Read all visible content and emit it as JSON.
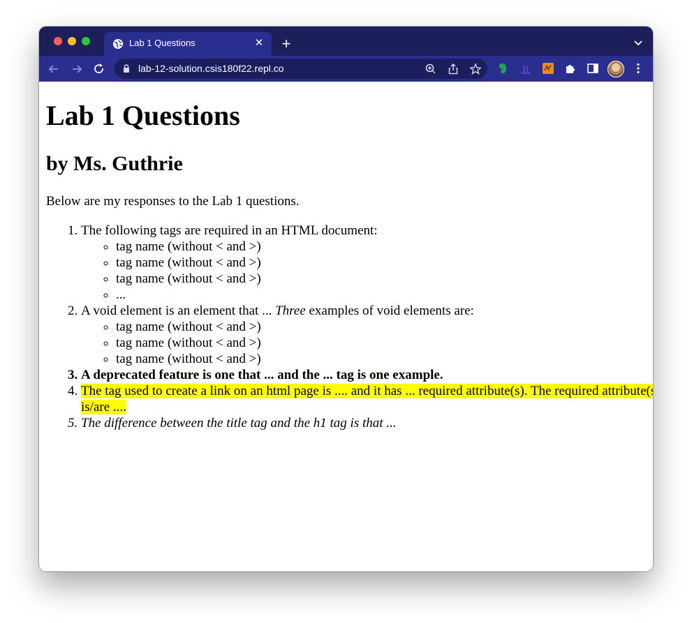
{
  "browser": {
    "tab_title": "Lab 1 Questions",
    "tab_close": "✕",
    "new_tab": "+",
    "url": "lab-12-solution.csis180f22.repl.co"
  },
  "page": {
    "title": "Lab 1 Questions",
    "subtitle": "by Ms. Guthrie",
    "intro": "Below are my responses to the Lab 1 questions.",
    "q1": {
      "text": "The following tags are required in an HTML document:",
      "items": [
        "tag name (without < and >)",
        "tag name (without < and >)",
        "tag name (without < and >)",
        "..."
      ]
    },
    "q2": {
      "before": "A void element is an element that ... ",
      "emph": "Three",
      "after": " examples of void elements are:",
      "items": [
        "tag name (without < and >)",
        "tag name (without < and >)",
        "tag name (without < and >)"
      ]
    },
    "q3": "A deprecated feature is one that ... and the ... tag is one example.",
    "q4": "The tag used to create a link on an html page is .... and it has ... required attribute(s). The required attribute(s) is/are ....",
    "q5": "The difference between the title tag and the h1 tag is that ..."
  },
  "colors": {
    "titlebar": "#1d1f5a",
    "toolbar": "#2a2e8f",
    "highlight": "#ffff00"
  }
}
